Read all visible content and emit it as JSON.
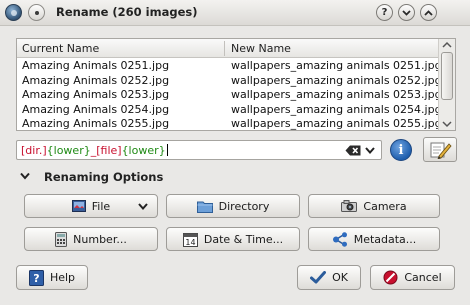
{
  "window": {
    "title": "Rename (260 images)"
  },
  "list": {
    "columns": [
      "Current Name",
      "New Name"
    ],
    "rows": [
      {
        "current": "Amazing Animals 0251.jpg",
        "new": "wallpapers_amazing animals 0251.jpg"
      },
      {
        "current": "Amazing Animals 0252.jpg",
        "new": "wallpapers_amazing animals 0252.jpg"
      },
      {
        "current": "Amazing Animals 0253.jpg",
        "new": "wallpapers_amazing animals 0253.jpg"
      },
      {
        "current": "Amazing Animals 0254.jpg",
        "new": "wallpapers_amazing animals 0254.jpg"
      },
      {
        "current": "Amazing Animals 0255.jpg",
        "new": "wallpapers_amazing animals 0255.jpg"
      }
    ]
  },
  "pattern": {
    "segments": [
      {
        "text": "[dir.]",
        "color": "red"
      },
      {
        "text": "{lower}",
        "color": "green"
      },
      {
        "text": "_",
        "color": "red"
      },
      {
        "text": "[file]",
        "color": "red"
      },
      {
        "text": "{lower}",
        "color": "green"
      }
    ],
    "value": "[dir.]{lower}_[file]{lower}"
  },
  "options": {
    "section_label": "Renaming Options",
    "buttons": {
      "file": "File",
      "directory": "Directory",
      "camera": "Camera",
      "number": "Number...",
      "date_time": "Date & Time...",
      "metadata": "Metadata..."
    }
  },
  "footer": {
    "help": "Help",
    "ok": "OK",
    "cancel": "Cancel"
  },
  "colors": {
    "pattern_red": "#c8102e",
    "pattern_green": "#1f8a14",
    "info_blue": "#1f5fae"
  },
  "icons": {
    "app": "app-icon",
    "sticky": "pin-icon",
    "help": "help-icon",
    "minimize": "minimize-icon",
    "maximize": "maximize-icon",
    "clear": "clear-icon",
    "dropdown": "chevron-down-icon",
    "info": "info-icon",
    "edit": "edit-icon",
    "file": "file-icon",
    "directory": "folder-icon",
    "camera": "camera-icon",
    "number": "calculator-icon",
    "date": "calendar-icon",
    "metadata": "share-icon",
    "ok": "checkmark-icon",
    "cancel": "cancel-icon"
  }
}
